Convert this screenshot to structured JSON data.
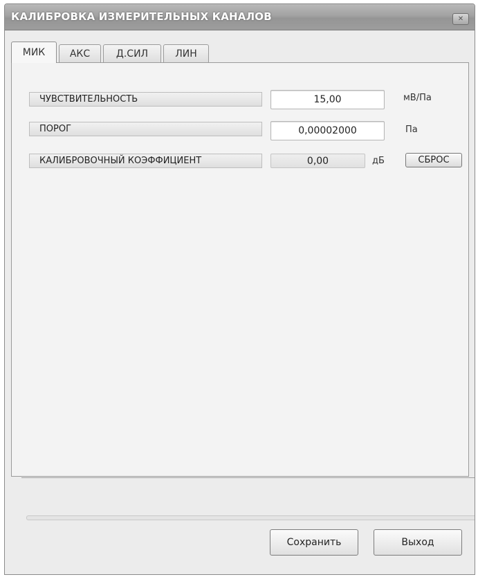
{
  "window": {
    "title": "КАЛИБРОВКА ИЗМЕРИТЕЛЬНЫХ КАНАЛОВ",
    "close_label": "✕"
  },
  "tabs": [
    {
      "label": "МИК"
    },
    {
      "label": "АКС"
    },
    {
      "label": "Д.СИЛ"
    },
    {
      "label": "ЛИН"
    }
  ],
  "active_tab": "МИК",
  "fields": {
    "sensitivity": {
      "label": "ЧУВСТВИТЕЛЬНОСТЬ",
      "value": "15,00",
      "unit": "мВ/Па"
    },
    "threshold": {
      "label": "ПОРОГ",
      "value": "0,00002000",
      "unit": "Па"
    },
    "cal_coeff": {
      "label": "КАЛИБРОВОЧНЫЙ КОЭФФИЦИЕНТ",
      "value": "0,00",
      "unit": "дБ",
      "reset_label": "СБРОС"
    }
  },
  "buttons": {
    "save_label": "Сохранить",
    "exit_label": "Выход"
  }
}
